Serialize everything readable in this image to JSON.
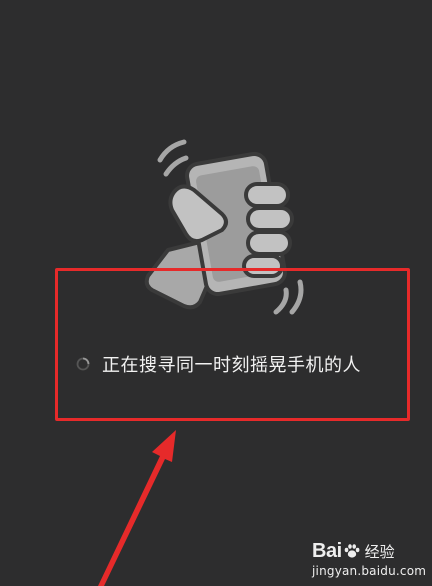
{
  "status": {
    "text": "正在搜寻同一时刻摇晃手机的人"
  },
  "graphic": {
    "icon": "shake-phone-hand-icon"
  },
  "watermark": {
    "brand_prefix": "Bai",
    "brand_suffix": "经验",
    "url": "jingyan.baidu.com"
  },
  "colors": {
    "background": "#2d2d2e",
    "highlight": "#e62a2a",
    "icon": "#a6a6a6",
    "status_text": "#f2f2f2"
  }
}
